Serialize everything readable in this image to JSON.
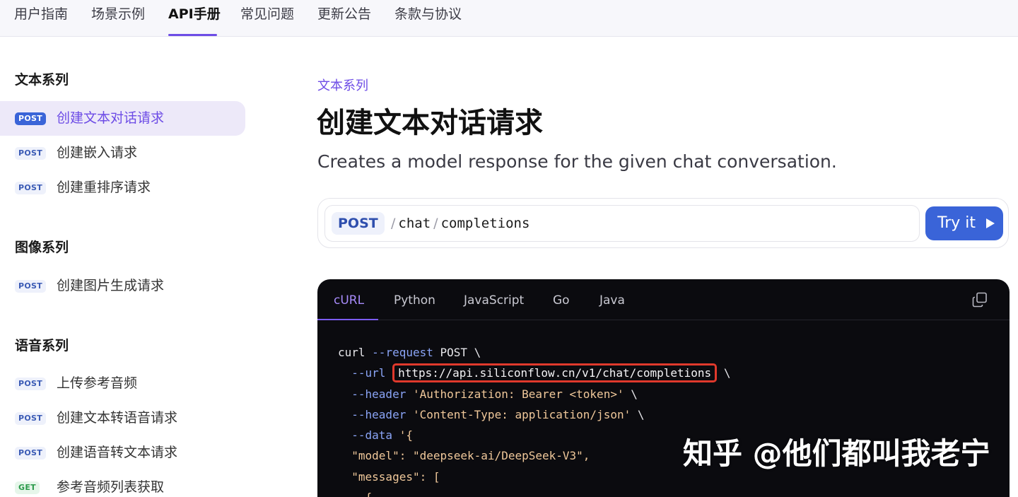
{
  "nav": {
    "items": [
      "用户指南",
      "场景示例",
      "API手册",
      "常见问题",
      "更新公告",
      "条款与协议"
    ],
    "active_index": 2
  },
  "sidebar": {
    "groups": [
      {
        "title": "文本系列",
        "items": [
          {
            "method": "POST",
            "label": "创建文本对话请求",
            "active": true
          },
          {
            "method": "POST",
            "label": "创建嵌入请求",
            "active": false
          },
          {
            "method": "POST",
            "label": "创建重排序请求",
            "active": false
          }
        ]
      },
      {
        "title": "图像系列",
        "items": [
          {
            "method": "POST",
            "label": "创建图片生成请求",
            "active": false
          }
        ]
      },
      {
        "title": "语音系列",
        "items": [
          {
            "method": "POST",
            "label": "上传参考音频",
            "active": false
          },
          {
            "method": "POST",
            "label": "创建文本转语音请求",
            "active": false
          },
          {
            "method": "POST",
            "label": "创建语音转文本请求",
            "active": false
          },
          {
            "method": "GET",
            "label": "参考音频列表获取",
            "active": false
          }
        ]
      }
    ]
  },
  "main": {
    "eyebrow": "文本系列",
    "title": "创建文本对话请求",
    "subtitle": "Creates a model response for the given chat conversation.",
    "endpoint": {
      "method": "POST",
      "path_sep": "/",
      "path_segments": [
        "chat",
        "completions"
      ],
      "try_label": "Try it"
    },
    "code": {
      "tabs": [
        "cURL",
        "Python",
        "JavaScript",
        "Go",
        "Java"
      ],
      "active_tab": 0,
      "lines": {
        "l1_cmd": "curl",
        "l1_flag": "--request",
        "l1_val": "POST \\",
        "l2_flag": "--url",
        "l2_url": "https://api.siliconflow.cn/v1/chat/completions",
        "l2_tail": " \\",
        "l3_flag": "--header",
        "l3_str": "'Authorization: Bearer <token>'",
        "l3_tail": " \\",
        "l4_flag": "--header",
        "l4_str": "'Content-Type: application/json'",
        "l4_tail": " \\",
        "l5_flag": "--data",
        "l5_str": "'{",
        "l6": "\"model\": \"deepseek-ai/DeepSeek-V3\",",
        "l7": "\"messages\": [",
        "l8": "{"
      }
    }
  },
  "watermark": "知乎 @他们都叫我老宁",
  "colors": {
    "accent": "#6d4ce6",
    "primary_button": "#3a64d8",
    "code_bg": "#0b0b0f",
    "highlight_box": "#e0392c"
  }
}
